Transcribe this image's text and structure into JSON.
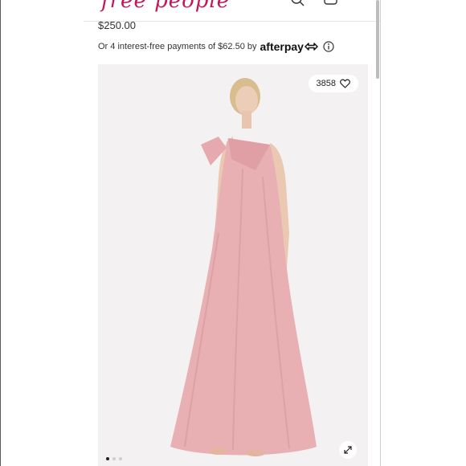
{
  "header": {
    "logo_text": "free people",
    "brand_color": "#c2185b",
    "icons": [
      "search-icon",
      "bag-icon",
      "menu-icon"
    ]
  },
  "product": {
    "price": "$250.00"
  },
  "afterpay": {
    "text": "Or 4 interest-free payments of $62.50 by",
    "brand": "afterpay"
  },
  "gallery": {
    "likes": "3858",
    "dress_color": "#e9b0b4",
    "dots_total": 3,
    "active_dot": 1
  }
}
